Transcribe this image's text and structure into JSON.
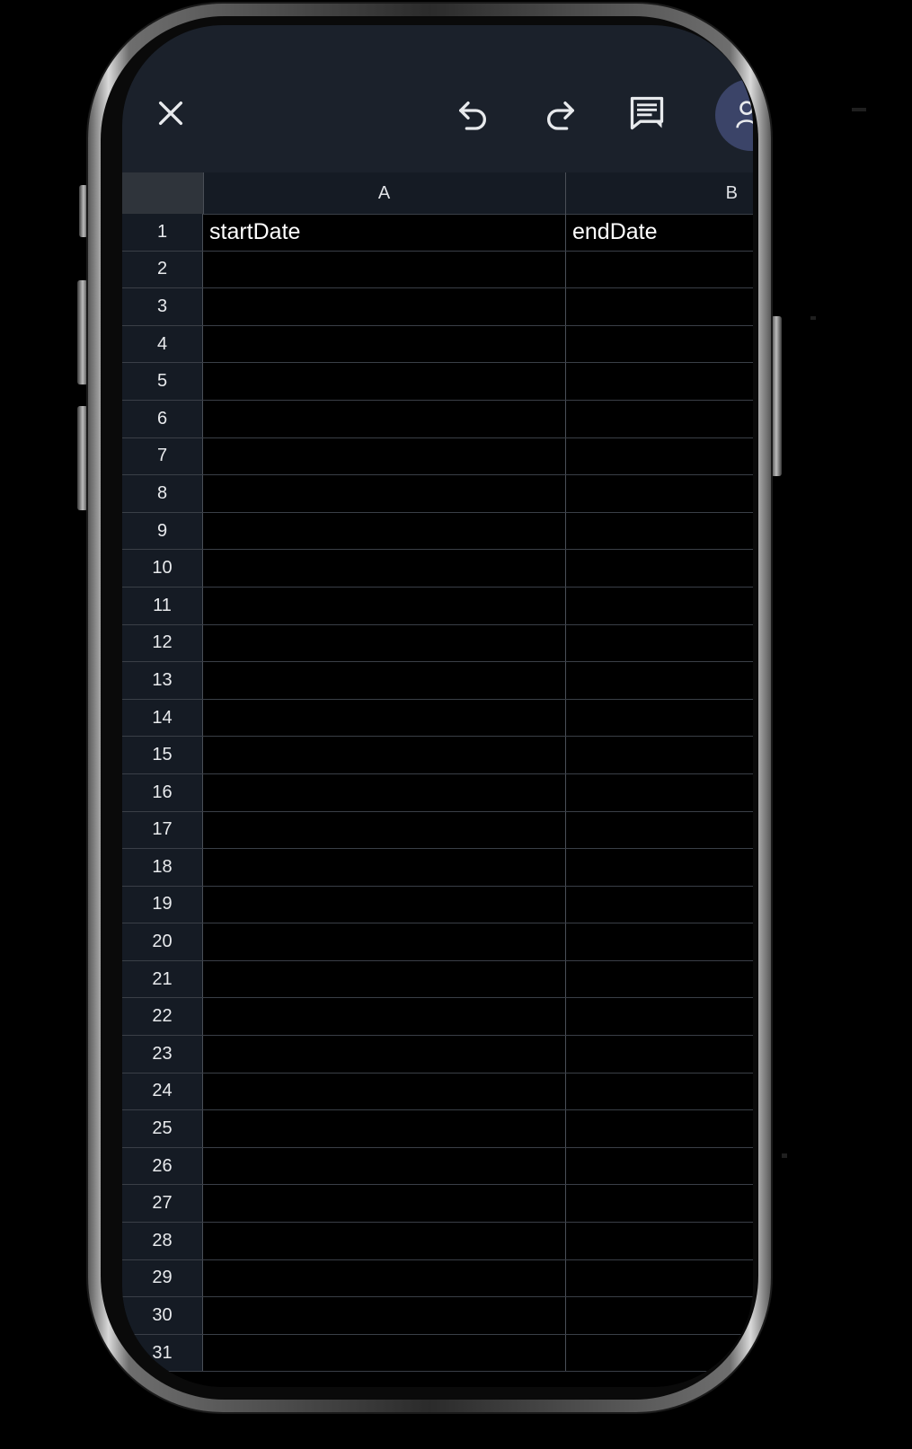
{
  "app": {
    "toolbar": {
      "close_icon": "close-icon",
      "undo_icon": "undo-icon",
      "redo_icon": "redo-icon",
      "comment_icon": "comment-icon",
      "avatar_icon": "person-icon"
    }
  },
  "sheet": {
    "columns": [
      {
        "letter": "A"
      },
      {
        "letter": "B"
      }
    ],
    "rows": [
      {
        "num": "1",
        "a": "startDate",
        "b": "endDate"
      },
      {
        "num": "2",
        "a": "",
        "b": ""
      },
      {
        "num": "3",
        "a": "",
        "b": ""
      },
      {
        "num": "4",
        "a": "",
        "b": ""
      },
      {
        "num": "5",
        "a": "",
        "b": ""
      },
      {
        "num": "6",
        "a": "",
        "b": ""
      },
      {
        "num": "7",
        "a": "",
        "b": ""
      },
      {
        "num": "8",
        "a": "",
        "b": ""
      },
      {
        "num": "9",
        "a": "",
        "b": ""
      },
      {
        "num": "10",
        "a": "",
        "b": ""
      },
      {
        "num": "11",
        "a": "",
        "b": ""
      },
      {
        "num": "12",
        "a": "",
        "b": ""
      },
      {
        "num": "13",
        "a": "",
        "b": ""
      },
      {
        "num": "14",
        "a": "",
        "b": ""
      },
      {
        "num": "15",
        "a": "",
        "b": ""
      },
      {
        "num": "16",
        "a": "",
        "b": ""
      },
      {
        "num": "17",
        "a": "",
        "b": ""
      },
      {
        "num": "18",
        "a": "",
        "b": ""
      },
      {
        "num": "19",
        "a": "",
        "b": ""
      },
      {
        "num": "20",
        "a": "",
        "b": ""
      },
      {
        "num": "21",
        "a": "",
        "b": ""
      },
      {
        "num": "22",
        "a": "",
        "b": ""
      },
      {
        "num": "23",
        "a": "",
        "b": ""
      },
      {
        "num": "24",
        "a": "",
        "b": ""
      },
      {
        "num": "25",
        "a": "",
        "b": ""
      },
      {
        "num": "26",
        "a": "",
        "b": ""
      },
      {
        "num": "27",
        "a": "",
        "b": ""
      },
      {
        "num": "28",
        "a": "",
        "b": ""
      },
      {
        "num": "29",
        "a": "",
        "b": ""
      },
      {
        "num": "30",
        "a": "",
        "b": ""
      },
      {
        "num": "31",
        "a": "",
        "b": ""
      }
    ]
  },
  "colors": {
    "toolbar_bg": "#1b212b",
    "header_bg": "#151b24",
    "grid_line": "#3a3f47",
    "avatar_bg": "#3b4468",
    "cell_bg": "#000000"
  }
}
